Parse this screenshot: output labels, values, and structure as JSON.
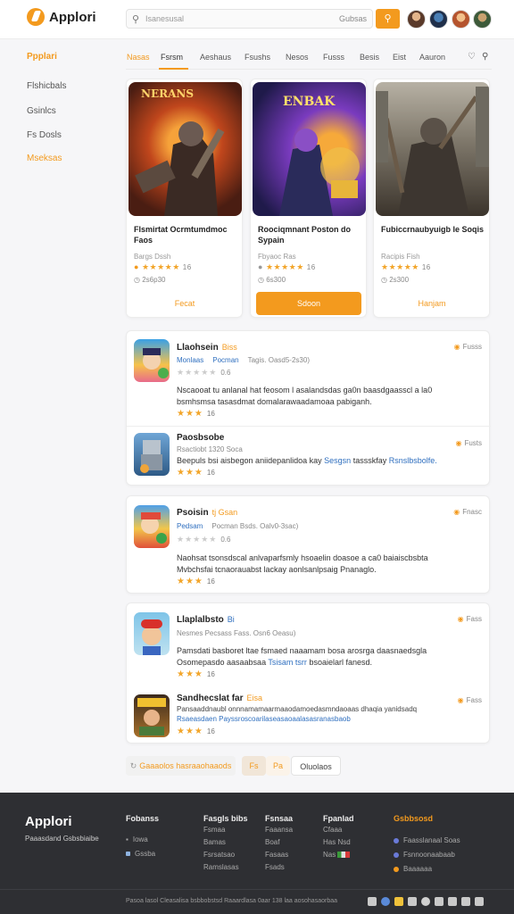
{
  "header": {
    "logo": "Applori",
    "search_placeholder": "Isanesusal",
    "search_right": "Gubsas",
    "search_button_icon": "search-icon"
  },
  "sidebar": {
    "title": "Ppplari",
    "items": [
      {
        "label": "Flshicbals",
        "active": false
      },
      {
        "label": "Gsinlcs",
        "active": false
      },
      {
        "label": "Fs Dosls",
        "active": false
      },
      {
        "label": "Mseksas",
        "active": true
      }
    ]
  },
  "nav": {
    "items": [
      "Nasas",
      "Fsrsm",
      "Aeshaus",
      "Fsushs",
      "Nesos",
      "Fusss",
      "Besis",
      "Eist",
      "Aauron"
    ]
  },
  "featured": [
    {
      "title": "Flsmirtat Ocrmtumdmoc Faos",
      "subtitle": "Bargs Dssh",
      "rating_count": "16",
      "meta": "2s6p30",
      "button": "Fecat",
      "art_text": "NERANS"
    },
    {
      "title": "Roociqmnant Poston do Sypain",
      "subtitle": "Fbyaoc Ras",
      "rating_count": "16",
      "meta": "6s300",
      "button": "Sdoon",
      "art_text": "ENBAK"
    },
    {
      "title": "Fubiccrnaubyuigb le Soqis",
      "subtitle": "Racipis Fish",
      "rating_count": "16",
      "meta": "2s300",
      "button": "Hanjam",
      "art_text": ""
    }
  ],
  "reviews_group1": [
    {
      "title": "Llaohsein",
      "tag": "Biss",
      "meta_blue_1": "Monlaas",
      "meta_blue_2": "Pocman",
      "meta_grey": "Tagis. Oasd5-2s30)",
      "light_rating": "0.6",
      "text": "Nscaooat tu anlanal hat feosom l asalandsdas ga0n baasdgaasscl a la0 bsmhsmsa tasasdmat domalarawaadamoaa pabiganh.",
      "rating": "16",
      "action": "Fusss"
    },
    {
      "title": "Paosbsobe",
      "tag": "",
      "meta_grey": "Rsactiobt 1320 Soca",
      "text_plain": "Beepuls bsi aisbegon aniidepanlidoa kay",
      "text_blue_1": "Sesgsn",
      "text_mid": "tassskfay",
      "text_blue_2": "Rsnslbsbolfe.",
      "rating": "16",
      "action": "Fusts"
    }
  ],
  "reviews_group2": [
    {
      "title": "Psoisin",
      "tag": "tj Gsan",
      "meta_blue_1": "Pedsam",
      "meta_grey": "Pocman  Bsds. Oalv0-3sac)",
      "light_rating": "0.6",
      "text": "Naohsat tsonsdscal anlvaparfsmly hsoaelin doasoe a ca0 baiaiscbsbta Mvbchsfai tcnaorauabst lackay aonlsanlpsaig Pnanaglo.",
      "rating": "16",
      "action": "Fnasc"
    }
  ],
  "reviews_group3": [
    {
      "title": "Llaplalbsto",
      "tag": "Bi",
      "meta_grey": "Nesmes  Pecsass  Fass. Osn6 Oeasu)",
      "text_plain": "Pamsdati basboret ltae fsmaed naaamam bosa arosrga daasnaedsgla Osomepasdo aasaabsaa",
      "text_blue": "Tsisam tsrr",
      "text_end": "bsoaielarl fanesd.",
      "rating": "16",
      "action": "Fass"
    },
    {
      "title": "Sandhecslat far",
      "tag": "Eisa",
      "meta_grey": "Pansaaddnaubl onnnamamaarmaaodamoedasmndaoaas dhaqia yanidsadq",
      "text_blue": "Rsaeasdaen Payssroscoarilaseasaoaalasasranasbaob",
      "rating": "16",
      "action": "Fass"
    }
  ],
  "pagination": {
    "main": "Gaaaolos hasraaohaaods",
    "btn1": "Fs",
    "btn2": "Pa",
    "next": "Oluolaos"
  },
  "footer": {
    "logo": "Applori",
    "tagline": "Paaasdand Gsbsbiaibe",
    "col1": {
      "head": "Fobanss",
      "links": [
        "Iowa",
        "Gssba"
      ]
    },
    "col2": {
      "head": "Fasgls bibs",
      "links": [
        "Fsmaa",
        "Bamas",
        "Fsrsatsao",
        "Ramslasas"
      ]
    },
    "col3": {
      "head": "Fsnsaa",
      "links": [
        "Faaansa",
        "Boaf",
        "Fasaas",
        "Fsads"
      ]
    },
    "col4": {
      "head": "Fpanlad",
      "links": [
        "Cfaaa",
        "Has Nsd",
        "Nas"
      ]
    },
    "col5": {
      "head": "Gsbbsosd",
      "links": [
        "Faasslanaal Soas",
        "Fsnnoonaabaab",
        "Baaaaaa"
      ]
    },
    "copyright": "Pasoa lasol Cleasalisa bsbbobstsd Raaardlasa 0aar 138  laa aosohasaorbaa"
  },
  "colors": {
    "accent": "#f39a1e",
    "link_blue": "#2f6fbf",
    "footer_bg": "#2e2f33"
  }
}
